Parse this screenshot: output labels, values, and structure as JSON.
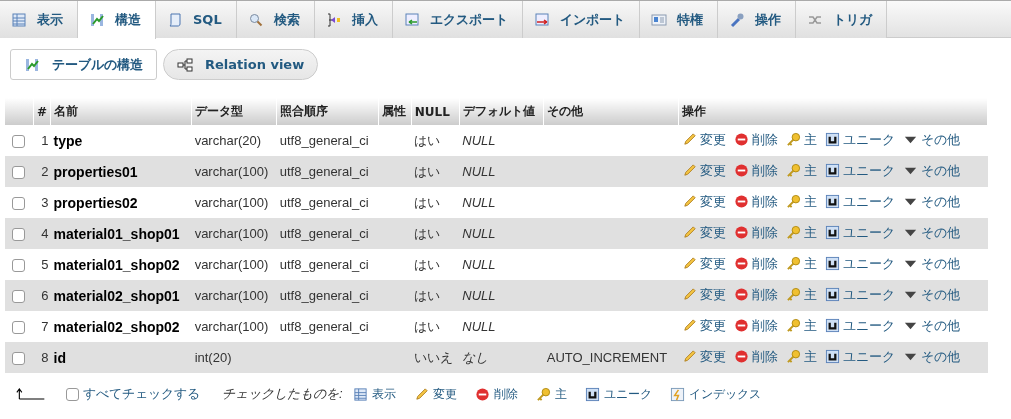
{
  "tabs": [
    {
      "label": "表示",
      "kind": "table",
      "selected": false
    },
    {
      "label": "構造",
      "kind": "structure",
      "selected": true
    },
    {
      "label": "SQL",
      "kind": "sql",
      "selected": false
    },
    {
      "label": "検索",
      "kind": "search",
      "selected": false
    },
    {
      "label": "挿入",
      "kind": "insert",
      "selected": false
    },
    {
      "label": "エクスポート",
      "kind": "export",
      "selected": false
    },
    {
      "label": "インポート",
      "kind": "import",
      "selected": false
    },
    {
      "label": "特権",
      "kind": "card",
      "selected": false
    },
    {
      "label": "操作",
      "kind": "wrench",
      "selected": false
    },
    {
      "label": "トリガ",
      "kind": "shuffle",
      "selected": false
    }
  ],
  "subtabs": [
    {
      "label": "テーブルの構造",
      "kind": "structure",
      "selected": true
    },
    {
      "label": "Relation view",
      "kind": "relation",
      "selected": false
    }
  ],
  "table": {
    "columns": [
      "#",
      "名前",
      "データ型",
      "照合順序",
      "属性",
      "NULL",
      "デフォルト値",
      "その他",
      "操作"
    ],
    "rows": [
      {
        "checked": false,
        "num": "1",
        "name": "type",
        "type": "varchar(20)",
        "collation": "utf8_general_ci",
        "null": "はい",
        "default": "NULL",
        "extra": "",
        "actions": [
          "変更",
          "削除",
          "主",
          "ユニーク",
          "その他"
        ]
      },
      {
        "checked": false,
        "num": "2",
        "name": "properties01",
        "type": "varchar(100)",
        "collation": "utf8_general_ci",
        "null": "はい",
        "default": "NULL",
        "extra": "",
        "actions": [
          "変更",
          "削除",
          "主",
          "ユニーク",
          "その他"
        ]
      },
      {
        "checked": false,
        "num": "3",
        "name": "properties02",
        "type": "varchar(100)",
        "collation": "utf8_general_ci",
        "null": "はい",
        "default": "NULL",
        "extra": "",
        "actions": [
          "変更",
          "削除",
          "主",
          "ユニーク",
          "その他"
        ]
      },
      {
        "checked": false,
        "num": "4",
        "name": "material01_shop01",
        "type": "varchar(100)",
        "collation": "utf8_general_ci",
        "null": "はい",
        "default": "NULL",
        "extra": "",
        "actions": [
          "変更",
          "削除",
          "主",
          "ユニーク",
          "その他"
        ]
      },
      {
        "checked": false,
        "num": "5",
        "name": "material01_shop02",
        "type": "varchar(100)",
        "collation": "utf8_general_ci",
        "null": "はい",
        "default": "NULL",
        "extra": "",
        "actions": [
          "変更",
          "削除",
          "主",
          "ユニーク",
          "その他"
        ]
      },
      {
        "checked": false,
        "num": "6",
        "name": "material02_shop01",
        "type": "varchar(100)",
        "collation": "utf8_general_ci",
        "null": "はい",
        "default": "NULL",
        "extra": "",
        "actions": [
          "変更",
          "削除",
          "主",
          "ユニーク",
          "その他"
        ]
      },
      {
        "checked": false,
        "num": "7",
        "name": "material02_shop02",
        "type": "varchar(100)",
        "collation": "utf8_general_ci",
        "null": "はい",
        "default": "NULL",
        "extra": "",
        "actions": [
          "変更",
          "削除",
          "主",
          "ユニーク",
          "その他"
        ]
      },
      {
        "checked": false,
        "num": "8",
        "name": "id",
        "type": "int(20)",
        "collation": "",
        "null": "いいえ",
        "default": "なし",
        "extra": "AUTO_INCREMENT",
        "actions": [
          "変更",
          "削除",
          "主",
          "ユニーク",
          "その他"
        ]
      }
    ]
  },
  "footer": {
    "check_all": {
      "label": "すべてチェックする",
      "checked": false
    },
    "with_selected": "チェックしたものを:",
    "actions": [
      {
        "label": "表示",
        "kind": "table"
      },
      {
        "label": "変更",
        "kind": "pencil"
      },
      {
        "label": "削除",
        "kind": "delete"
      },
      {
        "label": "主",
        "kind": "key"
      },
      {
        "label": "ユニーク",
        "kind": "unique"
      },
      {
        "label": "インデックス",
        "kind": "index"
      }
    ]
  }
}
